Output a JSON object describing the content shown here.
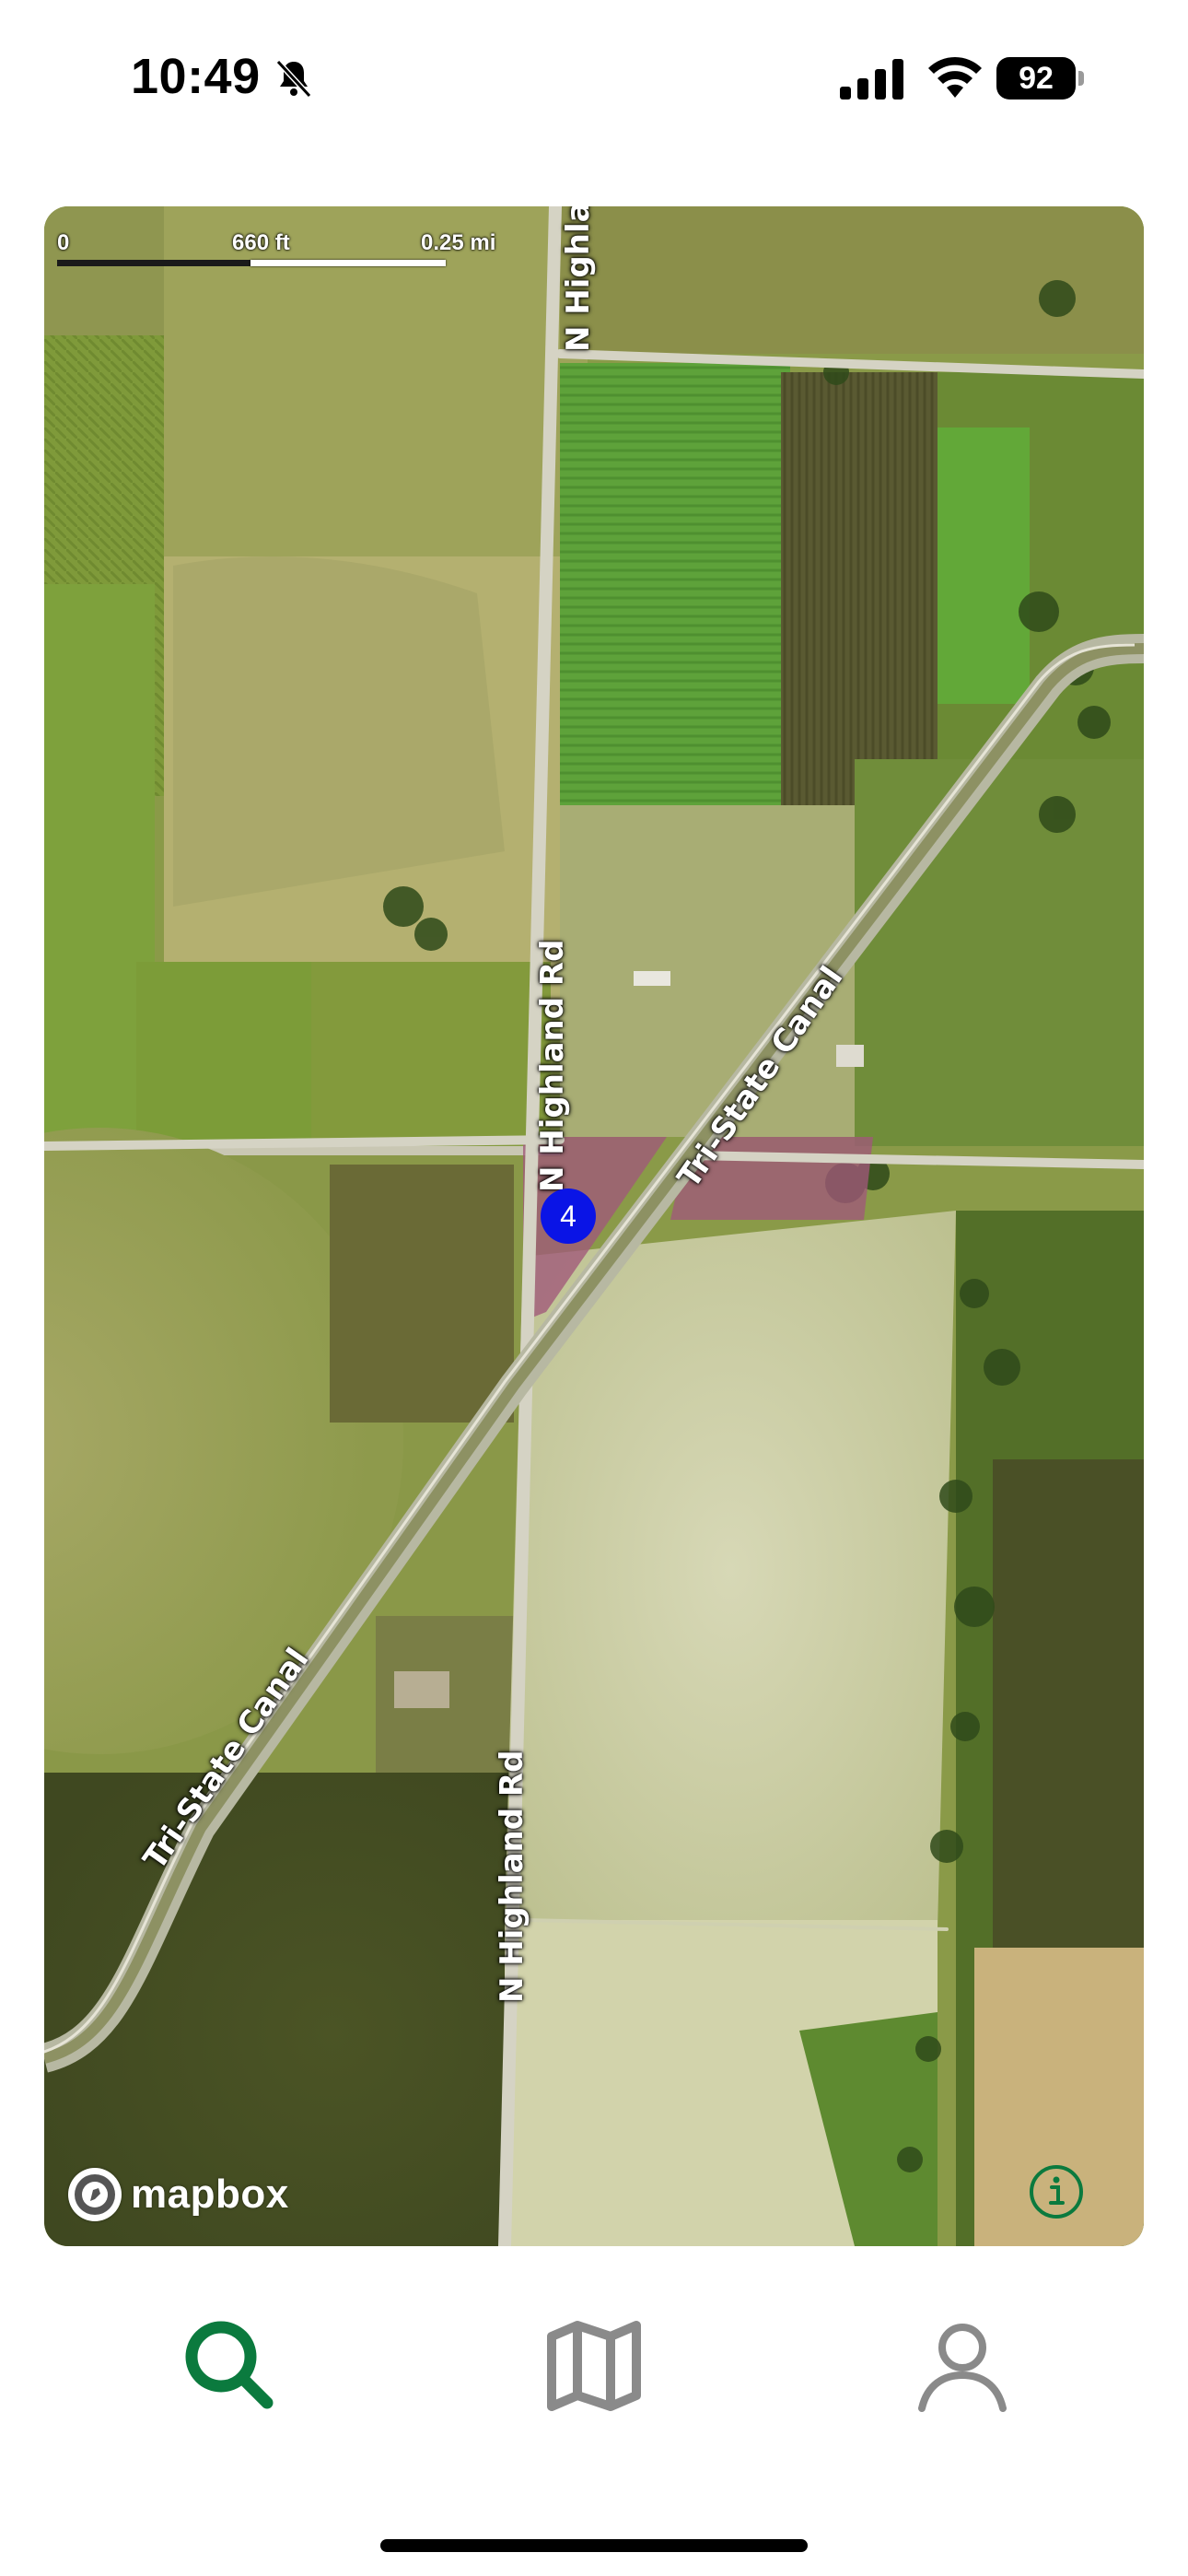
{
  "status_bar": {
    "time": "10:49",
    "battery": "92"
  },
  "map": {
    "scale": {
      "start": "0",
      "mid": "660 ft",
      "end": "0.25 mi"
    },
    "roads": [
      "N Highla",
      "N Highland Rd",
      "N Highland Rd",
      "Tri-State Canal",
      "Tri-State Canal"
    ],
    "marker_label": "4",
    "attribution": "mapbox",
    "colors": {
      "parcel": "#a0587a",
      "marker": "#0a14e6",
      "accent": "#0b7a3e"
    }
  },
  "tabbar": {
    "tabs": [
      {
        "name": "search",
        "icon": "search-icon",
        "active": true
      },
      {
        "name": "map",
        "icon": "map-icon",
        "active": false
      },
      {
        "name": "profile",
        "icon": "user-icon",
        "active": false
      }
    ]
  }
}
